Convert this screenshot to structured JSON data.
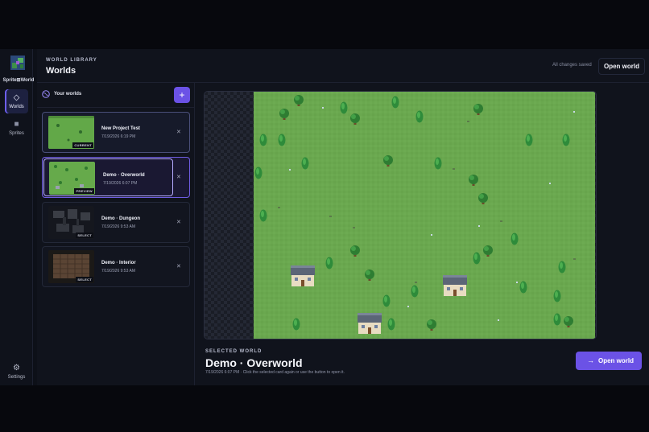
{
  "app": {
    "logo_text": "Sprite⊞World"
  },
  "rail": {
    "items": [
      {
        "label": "Worlds",
        "icon": "diamond-icon"
      },
      {
        "label": "Sprites",
        "icon": "square-icon"
      }
    ],
    "settings_label": "Settings",
    "settings_icon": "gear-icon"
  },
  "header": {
    "eyebrow": "WORLD LIBRARY",
    "title": "Worlds",
    "status": "All changes saved",
    "open_label": "Open world"
  },
  "list": {
    "title": "Your worlds",
    "add_label": "+",
    "cards": [
      {
        "name": "New Project Test",
        "date": "7/19/2026 6:19 PM",
        "badge": "CURRENT"
      },
      {
        "name": "Demo · Overworld",
        "date": "7/19/2026 6:07 PM",
        "badge": "PREVIEW"
      },
      {
        "name": "Demo · Dungeon",
        "date": "7/19/2026 9:53 AM",
        "badge": "SELECT"
      },
      {
        "name": "Demo · Interior",
        "date": "7/19/2026 9:53 AM",
        "badge": "SELECT"
      }
    ],
    "close_glyph": "✕"
  },
  "selected": {
    "eyebrow": "SELECTED WORLD",
    "title": "Demo · Overworld",
    "hint": "7/19/2026 6:07 PM · Click the selected card again or use the button to open it.",
    "open_label": "Open world",
    "open_icon": "→"
  },
  "colors": {
    "accent": "#6b52e6",
    "grass": "#6aa84f",
    "background": "#0d1018"
  }
}
